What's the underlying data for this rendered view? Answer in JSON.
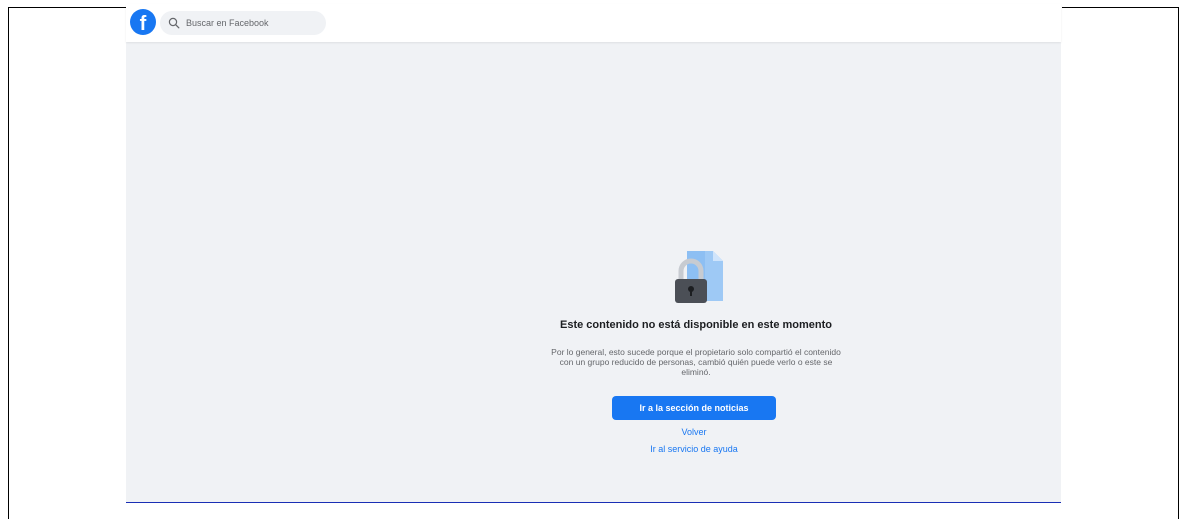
{
  "header": {
    "logo_letter": "f",
    "search": {
      "placeholder": "Buscar en Facebook"
    }
  },
  "main": {
    "title": "Este contenido no está disponible en este momento",
    "description": "Por lo general, esto sucede porque el propietario solo compartió el contenido con un grupo reducido de personas, cambió quién puede verlo o este se eliminó.",
    "primary_button": "Ir a la sección de noticias",
    "back_link": "Volver",
    "help_link": "Ir al servicio de ayuda"
  },
  "colors": {
    "brand": "#1877f2",
    "background": "#f0f2f5",
    "frame_underline": "#1a2fb5"
  },
  "icons": {
    "logo": "facebook-logo-icon",
    "search": "search-icon",
    "illustration": "locked-document-icon"
  }
}
